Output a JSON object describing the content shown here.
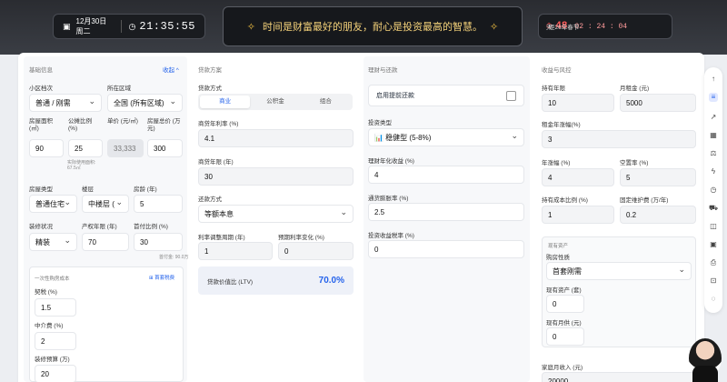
{
  "topbar": {
    "date": "12月30日周二",
    "time": "21:35:55",
    "quote": "时间是财富最好的朋友，耐心是投资最高的智慧。",
    "countdown_label": "距26年春节",
    "countdown_days": "48",
    "countdown_days_unit": "天",
    "countdown_hms": "02 : 24 : 04"
  },
  "basic": {
    "title": "基础信息",
    "collapse": "收起 ^",
    "building_label": "小区档次",
    "building_value": "普通 / 刚需",
    "region_label": "所在区域",
    "region_value": "全国 (所有区域)",
    "area_label": "房屋面积 (㎡)",
    "area_value": "90",
    "pool_label": "公摊比例 (%)",
    "pool_value": "25",
    "unit_price_label": "单价 (元/㎡)",
    "unit_price_value": "33,333",
    "total_label": "房屋总价 (万元)",
    "total_value": "300",
    "inner_area_hint": "实际使用面积: 67.5㎡",
    "house_type_label": "房屋类型",
    "house_type_value": "普通住宅",
    "floor_label": "楼层",
    "floor_value": "中楼层 (",
    "age_label": "房龄 (年)",
    "age_value": "5",
    "deco_label": "装修状况",
    "deco_value": "精装",
    "property_years_label": "产权年限 (年)",
    "property_years_value": "70",
    "down_ratio_label": "首付比例 (%)",
    "down_ratio_value": "30",
    "down_hint": "首付金: 90.0万"
  },
  "onetime": {
    "title": "一次性购房成本",
    "link": "⊞ 首套税费",
    "deed_label": "契税 (%)",
    "deed_value": "1.5",
    "agency_label": "中介费 (%)",
    "agency_value": "2",
    "reno_label": "装修预算 (万)",
    "reno_value": "20"
  },
  "loan": {
    "title": "贷款方案",
    "method_label": "贷款方式",
    "tabs": [
      "商业",
      "公积金",
      "组合"
    ],
    "rate_label": "商贷年利率 (%)",
    "rate_value": "4.1",
    "years_label": "商贷年限 (年)",
    "years_value": "30",
    "repay_label": "还款方式",
    "repay_value": "等额本息",
    "rate_change_cycle_label": "利率调整周期 (年)",
    "rate_change_cycle_value": "1",
    "rate_change_label": "预期利率变化 (%)",
    "rate_change_value": "0",
    "ltv_label": "贷款价值比 (LTV)",
    "ltv_value": "70.0%"
  },
  "invest": {
    "title": "理财与还款",
    "prepay_label": "启用提前还款",
    "type_label": "投资类型",
    "type_value": "📊 稳健型 (5-8%)",
    "return_label": "理财年化收益 (%)",
    "return_value": "4",
    "inflation_label": "通货膨胀率 (%)",
    "inflation_value": "2.5",
    "tax_label": "投资收益税率 (%)",
    "tax_value": "0"
  },
  "income": {
    "title": "收益与风控",
    "hold_label": "持有年限",
    "hold_value": "10",
    "rent_label": "月租金 (元)",
    "rent_value": "5000",
    "rent_growth_label": "租金年涨幅(%)",
    "rent_growth_value": "3",
    "appreciation_label": "年涨幅 (%)",
    "appreciation_value": "4",
    "vacancy_label": "空置率 (%)",
    "vacancy_value": "5",
    "holding_cost_label": "持有成本比例 (%)",
    "holding_cost_value": "1",
    "maint_label": "固定维护费 (万/年)",
    "maint_value": "0.2",
    "assets_title": "现有资产",
    "buy_nature_label": "购房性质",
    "buy_nature_value": "首套刚需",
    "existing_assets_label": "现有资产 (套)",
    "existing_assets_value": "0",
    "existing_payment_label": "现有月供 (元)",
    "existing_payment_value": "0",
    "family_income_label": "家庭月收入 (元)",
    "family_income_value": "20000"
  },
  "sidebar_icons": [
    "arrow-up-icon",
    "list-icon",
    "trend-icon",
    "grid-icon",
    "scale-icon",
    "bolt-icon",
    "clock-icon",
    "car-icon",
    "stack-icon",
    "calendar-icon",
    "print-icon",
    "bag-icon",
    "chat-icon"
  ]
}
